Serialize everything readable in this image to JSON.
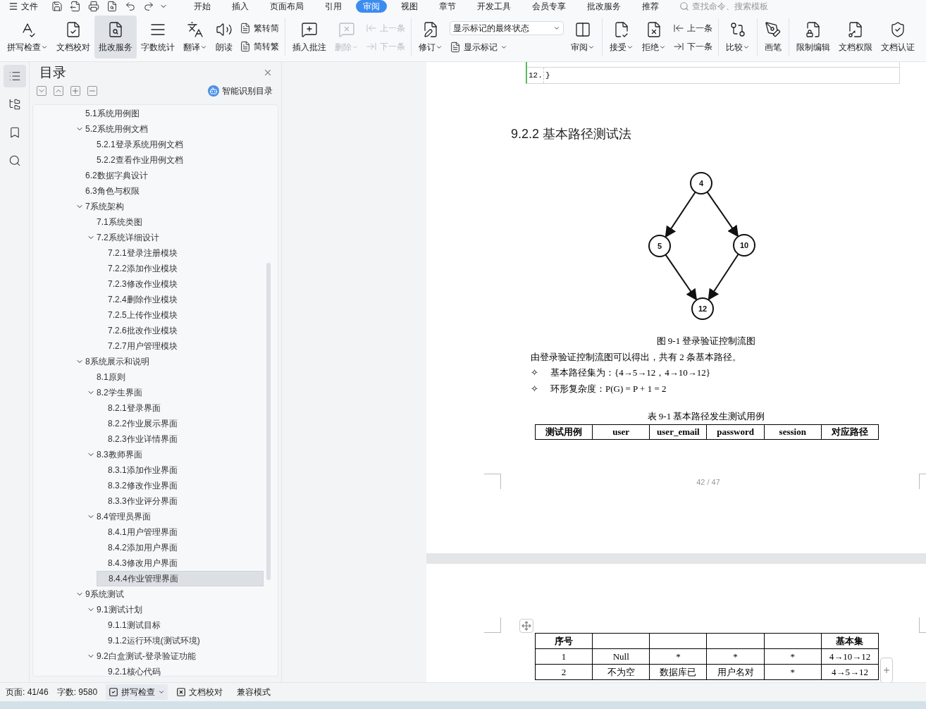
{
  "menu": {
    "file": "文件",
    "tabs": [
      {
        "label": "开始",
        "selected": false
      },
      {
        "label": "插入",
        "selected": false
      },
      {
        "label": "页面布局",
        "selected": false
      },
      {
        "label": "引用",
        "selected": false
      },
      {
        "label": "审阅",
        "selected": true
      },
      {
        "label": "视图",
        "selected": false
      },
      {
        "label": "章节",
        "selected": false
      },
      {
        "label": "开发工具",
        "selected": false
      },
      {
        "label": "会员专享",
        "selected": false
      },
      {
        "label": "批改服务",
        "selected": false
      },
      {
        "label": "推荐",
        "selected": false
      }
    ],
    "search": {
      "placeholder": "查找命令、搜索模板"
    }
  },
  "ribbon": [
    {
      "kind": "large",
      "label": "拼写检查",
      "dropdown": true,
      "selected": false,
      "disabled": false
    },
    {
      "kind": "large",
      "label": "文档校对",
      "dropdown": false,
      "selected": false,
      "disabled": false
    },
    {
      "kind": "large",
      "label": "批改服务",
      "dropdown": false,
      "selected": true,
      "disabled": false
    },
    {
      "kind": "large",
      "label": "字数统计",
      "dropdown": false,
      "selected": false,
      "disabled": false
    },
    {
      "kind": "large",
      "label": "翻译",
      "dropdown": true,
      "selected": false,
      "disabled": false
    },
    {
      "kind": "large",
      "label": "朗读",
      "dropdown": false,
      "selected": false,
      "disabled": false
    },
    {
      "kind": "stack",
      "items": [
        {
          "label": "繁转简",
          "disabled": false
        },
        {
          "label": "简转繁",
          "disabled": false
        }
      ]
    },
    {
      "kind": "separator"
    },
    {
      "kind": "large",
      "label": "插入批注",
      "dropdown": false,
      "selected": false,
      "disabled": false
    },
    {
      "kind": "large",
      "label": "删除",
      "dropdown": true,
      "selected": false,
      "disabled": true
    },
    {
      "kind": "stack",
      "items": [
        {
          "label": "上一条",
          "disabled": true
        },
        {
          "label": "下一条",
          "disabled": true
        }
      ]
    },
    {
      "kind": "separator"
    },
    {
      "kind": "large",
      "label": "修订",
      "dropdown": true,
      "selected": false,
      "disabled": false
    },
    {
      "kind": "select",
      "value": "显示标记的最终状态",
      "button": {
        "label": "显示标记",
        "dropdown": true
      }
    },
    {
      "kind": "large",
      "label": "审阅",
      "dropdown": true,
      "selected": false,
      "disabled": false
    },
    {
      "kind": "separator"
    },
    {
      "kind": "large",
      "label": "接受",
      "dropdown": true,
      "selected": false,
      "disabled": false
    },
    {
      "kind": "large",
      "label": "拒绝",
      "dropdown": true,
      "selected": false,
      "disabled": false
    },
    {
      "kind": "stack",
      "items": [
        {
          "label": "上一条",
          "disabled": false
        },
        {
          "label": "下一条",
          "disabled": false
        }
      ]
    },
    {
      "kind": "separator"
    },
    {
      "kind": "large",
      "label": "比较",
      "dropdown": true,
      "selected": false,
      "disabled": false
    },
    {
      "kind": "separator"
    },
    {
      "kind": "large",
      "label": "画笔",
      "dropdown": false,
      "selected": false,
      "disabled": false
    },
    {
      "kind": "separator"
    },
    {
      "kind": "large",
      "label": "限制编辑",
      "dropdown": false,
      "selected": false,
      "disabled": false
    },
    {
      "kind": "large",
      "label": "文档权限",
      "dropdown": false,
      "selected": false,
      "disabled": false
    },
    {
      "kind": "large",
      "label": "文档认证",
      "dropdown": false,
      "selected": false,
      "disabled": false
    }
  ],
  "rail": [
    {
      "selected": true
    },
    {
      "selected": false
    },
    {
      "selected": false
    },
    {
      "selected": false
    }
  ],
  "toc": {
    "title": "目录",
    "smart": "智能识别目录",
    "items": [
      {
        "children": [
          {
            "label": "5.1系统用例图",
            "selected": false
          },
          {
            "label": "5.2系统用例文档",
            "expanded": true,
            "selected": false,
            "children": [
              {
                "label": "5.2.1登录系统用例文档",
                "selected": false
              },
              {
                "label": "5.2.2查看作业用例文档",
                "selected": false
              }
            ]
          },
          {
            "label": "6.2数据字典设计",
            "selected": false
          },
          {
            "label": "6.3角色与权限",
            "selected": false
          }
        ]
      },
      {
        "label": "7系统架构",
        "expanded": true,
        "selected": false,
        "children": [
          {
            "label": "7.1系统类图",
            "selected": false
          },
          {
            "label": "7.2系统详细设计",
            "expanded": true,
            "selected": false,
            "children": [
              {
                "label": "7.2.1登录注册模块",
                "selected": false
              },
              {
                "label": "7.2.2添加作业模块",
                "selected": false
              },
              {
                "label": "7.2.3修改作业模块",
                "selected": false
              },
              {
                "label": "7.2.4删除作业模块",
                "selected": false
              },
              {
                "label": "7.2.5上传作业模块",
                "selected": false
              },
              {
                "label": "7.2.6批改作业模块",
                "selected": false
              },
              {
                "label": "7.2.7用户管理模块",
                "selected": false
              }
            ]
          }
        ]
      },
      {
        "label": "8系统展示和说明",
        "expanded": true,
        "selected": false,
        "children": [
          {
            "label": "8.1原则",
            "selected": false
          },
          {
            "label": "8.2学生界面",
            "expanded": true,
            "selected": false,
            "children": [
              {
                "label": "8.2.1登录界面",
                "selected": false
              },
              {
                "label": "8.2.2作业展示界面",
                "selected": false
              },
              {
                "label": "8.2.3作业详情界面",
                "selected": false
              }
            ]
          },
          {
            "label": "8.3教师界面",
            "expanded": true,
            "selected": false,
            "children": [
              {
                "label": "8.3.1添加作业界面",
                "selected": false
              },
              {
                "label": "8.3.2修改作业界面",
                "selected": false
              },
              {
                "label": "8.3.3作业评分界面",
                "selected": false
              }
            ]
          },
          {
            "label": "8.4管理员界面",
            "expanded": true,
            "selected": false,
            "children": [
              {
                "label": "8.4.1用户管理界面",
                "selected": false
              },
              {
                "label": "8.4.2添加用户界面",
                "selected": false
              },
              {
                "label": "8.4.3修改用户界面",
                "selected": false
              },
              {
                "label": "8.4.4作业管理界面",
                "selected": true
              }
            ]
          }
        ]
      },
      {
        "label": "9系统测试",
        "expanded": true,
        "selected": false,
        "children": [
          {
            "label": "9.1测试计划",
            "expanded": true,
            "selected": false,
            "children": [
              {
                "label": "9.1.1测试目标",
                "selected": false
              },
              {
                "label": "9.1.2运行环境(测试环境)",
                "selected": false
              }
            ]
          },
          {
            "label": "9.2白盒测试-登录验证功能",
            "expanded": true,
            "selected": false,
            "children": [
              {
                "label": "9.2.1核心代码",
                "selected": false
              }
            ]
          }
        ]
      }
    ]
  },
  "document": {
    "code": {
      "line_number": "12.",
      "text": "}"
    },
    "heading": "9.2.2  基本路径测试法",
    "graph": {
      "nodes": [
        "4",
        "5",
        "10",
        "12"
      ]
    },
    "figure_caption": "图 9-1 登录验证控制流图",
    "paragraph": "由登录验证控制流图可以得出，共有 2 条基本路径。",
    "bullets": [
      {
        "marker": "✧",
        "text": "基本路径集为：{4→5→12，4→10→12}"
      },
      {
        "marker": "✧",
        "text": "环形复杂度：P(G) = P + 1 = 2"
      }
    ],
    "table_caption": "表 9-1 基本路径发生测试用例",
    "table_header": [
      "测试用例",
      "user",
      "user_email",
      "password",
      "session",
      "对应路径"
    ],
    "page_number": "42 / 47",
    "table2_rows": [
      {
        "cells": [
          "序号",
          null,
          null,
          null,
          null,
          "基本集"
        ],
        "header": true
      },
      {
        "cells": [
          "1",
          "Null",
          "*",
          "*",
          "*",
          "4→10→12"
        ],
        "header": false
      },
      {
        "cells": [
          "2",
          "不为空",
          "数据库已",
          "用户名对",
          "*",
          "4→5→12"
        ],
        "header": false
      }
    ]
  },
  "status_bar": {
    "page": "页面: 41/46",
    "words": "字数: 9580",
    "spell": "拼写检查",
    "proof": "文档校对",
    "mode": "兼容模式"
  }
}
